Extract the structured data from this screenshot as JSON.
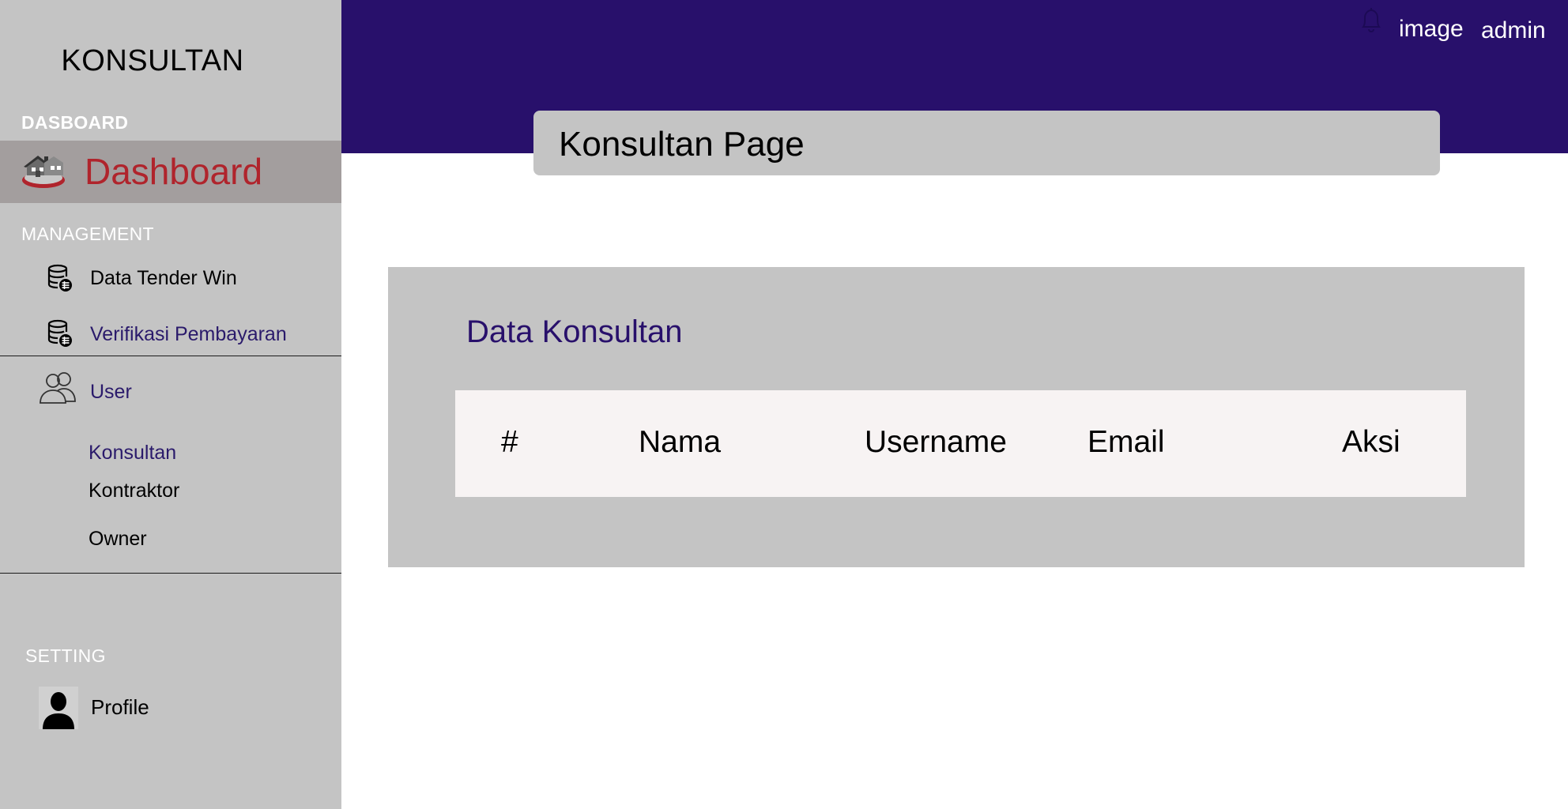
{
  "sidebar": {
    "brand": "KONSULTAN",
    "sections": {
      "dasboard": "DASBOARD",
      "management": "MANAGEMENT",
      "setting": "SETTING"
    },
    "dashboard": {
      "label": "Dashboard",
      "icon": "house-icon",
      "color": "#b0242c"
    },
    "items": [
      {
        "label": "Data Tender Win",
        "icon": "database-icon"
      },
      {
        "label": "Verifikasi Pembayaran",
        "icon": "database-icon"
      },
      {
        "label": "User",
        "icon": "users-icon"
      }
    ],
    "user_submenu": [
      "Konsultan",
      "Kontraktor",
      "Owner"
    ],
    "profile": {
      "label": "Profile",
      "icon": "person-icon"
    }
  },
  "header": {
    "bell_icon": "bell-icon",
    "image_text": "image",
    "user": "admin",
    "page_title": "Konsultan Page"
  },
  "card": {
    "title": "Data Konsultan",
    "columns": [
      "#",
      "Nama",
      "Username",
      "Email",
      "Aksi"
    ]
  },
  "colors": {
    "header": "#28106b",
    "sidebar": "#c4c4c4",
    "active_item_bg": "#a39e9e",
    "accent_text": "#2a1a6b"
  }
}
